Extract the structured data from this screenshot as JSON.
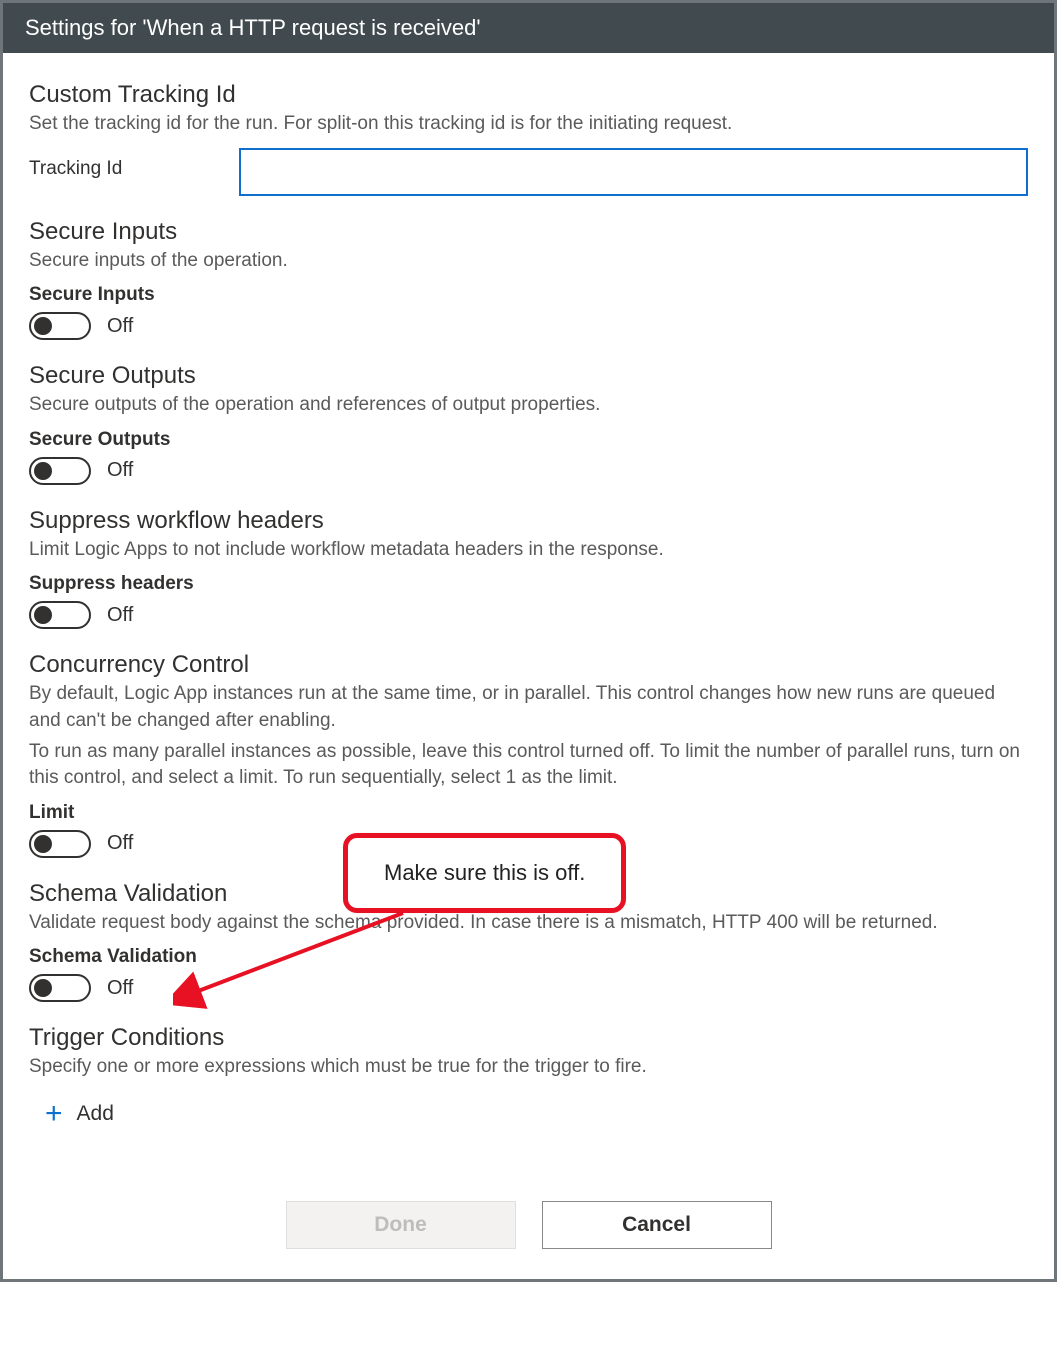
{
  "header": {
    "title": "Settings for 'When a HTTP request is received'"
  },
  "sections": {
    "tracking": {
      "title": "Custom Tracking Id",
      "desc": "Set the tracking id for the run. For split-on this tracking id is for the initiating request.",
      "field_label": "Tracking Id",
      "value": ""
    },
    "secureInputs": {
      "title": "Secure Inputs",
      "desc": "Secure inputs of the operation.",
      "toggle_label": "Secure Inputs",
      "state": "Off"
    },
    "secureOutputs": {
      "title": "Secure Outputs",
      "desc": "Secure outputs of the operation and references of output properties.",
      "toggle_label": "Secure Outputs",
      "state": "Off"
    },
    "suppress": {
      "title": "Suppress workflow headers",
      "desc": "Limit Logic Apps to not include workflow metadata headers in the response.",
      "toggle_label": "Suppress headers",
      "state": "Off"
    },
    "concurrency": {
      "title": "Concurrency Control",
      "desc1": "By default, Logic App instances run at the same time, or in parallel. This control changes how new runs are queued and can't be changed after enabling.",
      "desc2": "To run as many parallel instances as possible, leave this control turned off. To limit the number of parallel runs, turn on this control, and select a limit. To run sequentially, select 1 as the limit.",
      "toggle_label": "Limit",
      "state": "Off"
    },
    "schema": {
      "title": "Schema Validation",
      "desc": "Validate request body against the schema provided. In case there is a mismatch, HTTP 400 will be returned.",
      "toggle_label": "Schema Validation",
      "state": "Off"
    },
    "trigger": {
      "title": "Trigger Conditions",
      "desc": "Specify one or more expressions which must be true for the trigger to fire.",
      "add_label": "Add"
    }
  },
  "footer": {
    "done": "Done",
    "cancel": "Cancel"
  },
  "annotation": {
    "text": "Make sure this is off."
  }
}
